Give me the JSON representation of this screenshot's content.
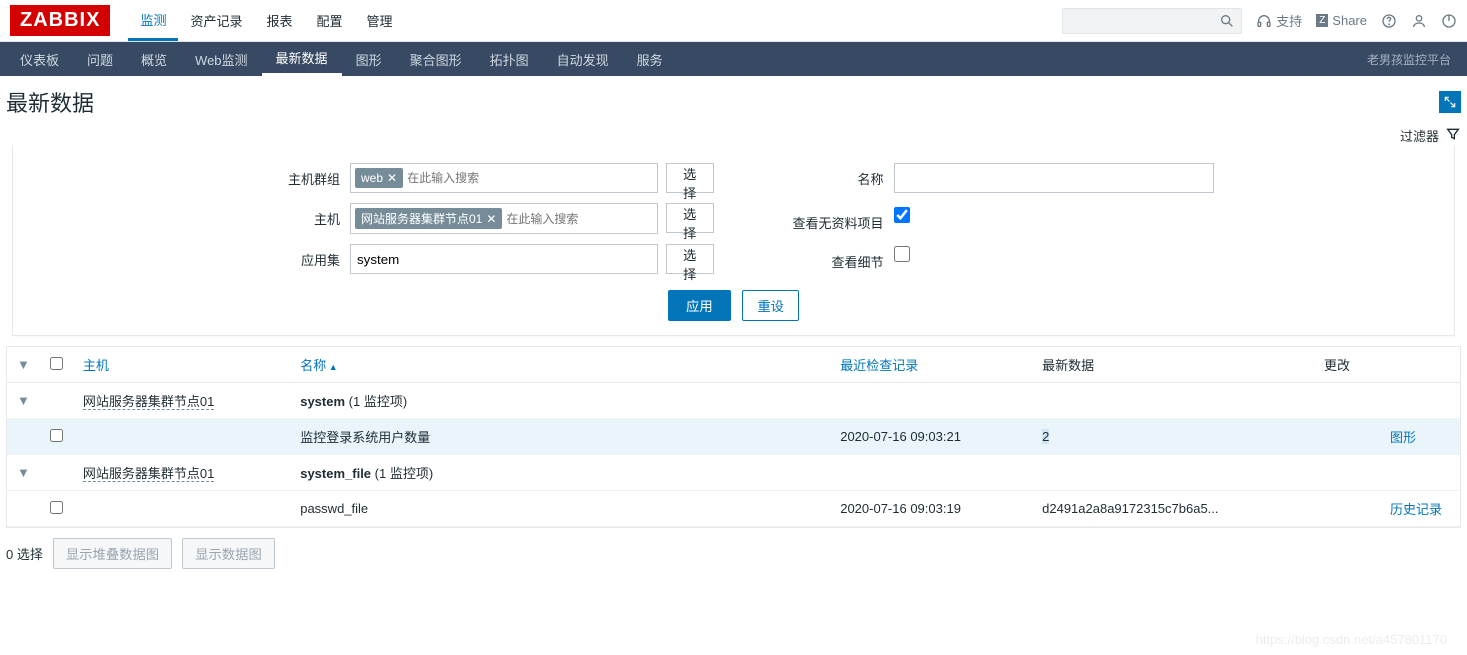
{
  "brand": "ZABBIX",
  "topnav": [
    "监测",
    "资产记录",
    "报表",
    "配置",
    "管理"
  ],
  "topnav_active": 0,
  "topright": {
    "support": "支持",
    "share": "Share"
  },
  "subnav": [
    "仪表板",
    "问题",
    "概览",
    "Web监测",
    "最新数据",
    "图形",
    "聚合图形",
    "拓扑图",
    "自动发现",
    "服务"
  ],
  "subnav_active": 4,
  "subnav_right": "老男孩监控平台",
  "page_title": "最新数据",
  "filter_label": "过滤器",
  "filter": {
    "hostgroup_label": "主机群组",
    "hostgroup_tag": "web",
    "hostgroup_placeholder": "在此输入搜索",
    "host_label": "主机",
    "host_tag": "网站服务器集群节点01",
    "host_placeholder": "在此输入搜索",
    "app_label": "应用集",
    "app_value": "system",
    "select_btn": "选择",
    "name_label": "名称",
    "name_value": "",
    "show_nodata_label": "查看无资料项目",
    "show_nodata_checked": true,
    "show_detail_label": "查看细节",
    "show_detail_checked": false,
    "apply": "应用",
    "reset": "重设"
  },
  "table": {
    "headers": {
      "host": "主机",
      "name": "名称",
      "last_check": "最近检查记录",
      "last_data": "最新数据",
      "change": "更改"
    },
    "rows": [
      {
        "type": "group",
        "host": "网站服务器集群节点01",
        "app": "system",
        "count_label": "(1 监控项)"
      },
      {
        "type": "item",
        "name": "监控登录系统用户数量",
        "last_check": "2020-07-16 09:03:21",
        "last_data": "2",
        "action": "图形",
        "highlight": true
      },
      {
        "type": "group",
        "host": "网站服务器集群节点01",
        "app": "system_file",
        "count_label": "(1 监控项)"
      },
      {
        "type": "item",
        "name": "passwd_file",
        "last_check": "2020-07-16 09:03:19",
        "last_data": "d2491a2a8a9172315c7b6a5...",
        "action": "历史记录"
      }
    ]
  },
  "footer": {
    "selected": "0 选择",
    "stacked_btn": "显示堆叠数据图",
    "graph_btn": "显示数据图"
  },
  "watermark": "https://blog.csdn.net/a457801170"
}
